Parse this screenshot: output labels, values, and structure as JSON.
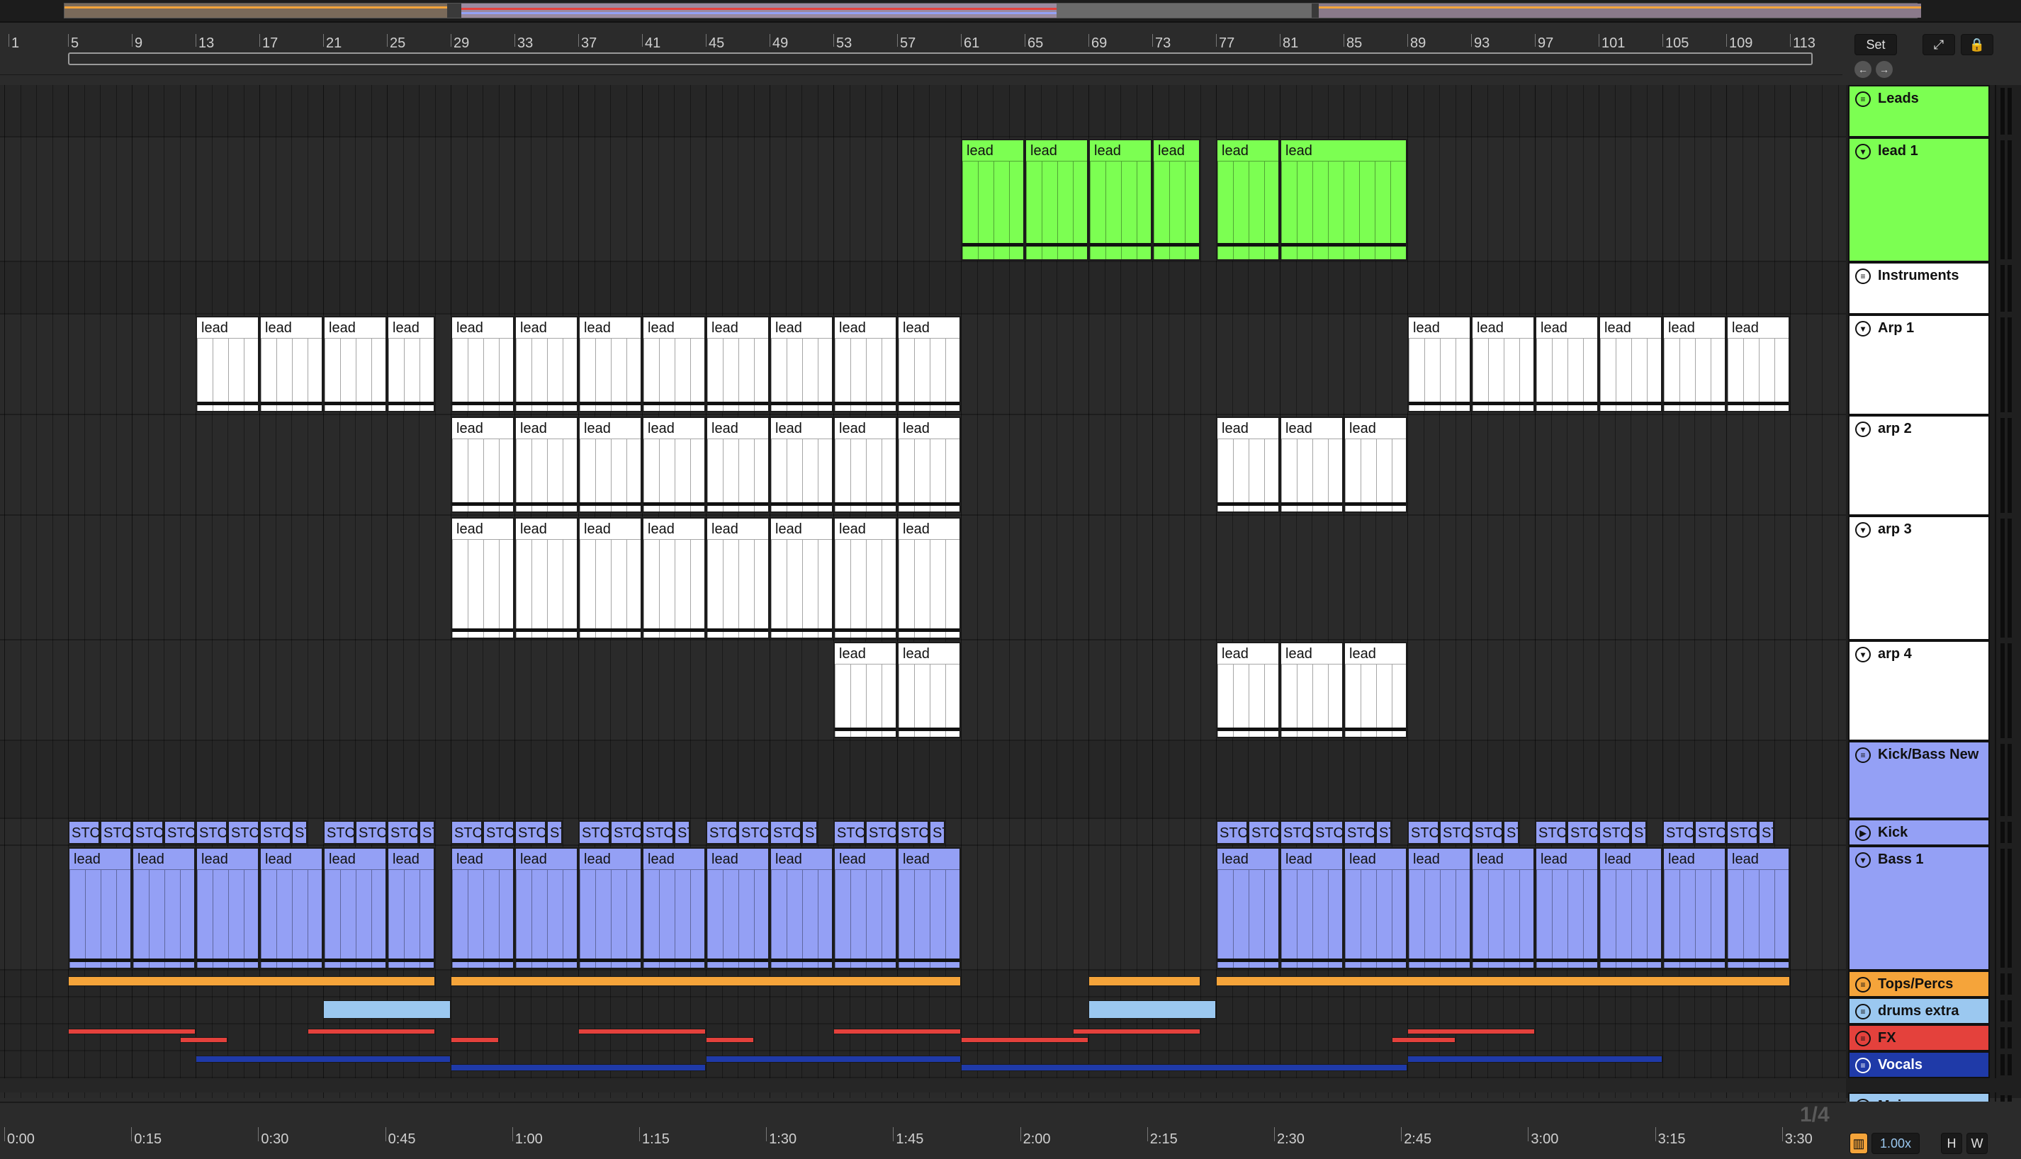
{
  "ruler": {
    "bars": [
      "1",
      "5",
      "9",
      "13",
      "17",
      "21",
      "25",
      "29",
      "33",
      "37",
      "41",
      "45",
      "49",
      "53",
      "57",
      "61",
      "65",
      "69",
      "73",
      "77",
      "81",
      "85",
      "89",
      "93",
      "97",
      "101",
      "105",
      "109",
      "113"
    ]
  },
  "timebar": {
    "labels": [
      "0:00",
      "0:15",
      "0:30",
      "0:45",
      "1:00",
      "1:15",
      "1:30",
      "1:45",
      "2:00",
      "2:15",
      "2:30",
      "2:45",
      "3:00",
      "3:15",
      "3:30"
    ],
    "grid": "1/4"
  },
  "set_panel": {
    "set_label": "Set",
    "zoom": "1.00x",
    "h_label": "H",
    "w_label": "W"
  },
  "colors": {
    "leads": "#7CFF52",
    "white": "#ffffff",
    "bass": "#94a0f5",
    "tops": "#f5a43a",
    "drums_extra": "#9bc8f0",
    "fx": "#e4413c",
    "vocals": "#1f3aa8",
    "main": "#9bc8f0"
  },
  "tracks": [
    {
      "id": "leads",
      "name": "Leads",
      "type": "group",
      "color": "#7CFF52",
      "icon": "group-icon"
    },
    {
      "id": "lead1",
      "name": "lead 1",
      "type": "midi",
      "color": "#7CFF52",
      "icon": "fold-icon"
    },
    {
      "id": "instruments",
      "name": "Instruments",
      "type": "group",
      "color": "#ffffff",
      "icon": "group-icon"
    },
    {
      "id": "arp1",
      "name": "Arp 1",
      "type": "midi",
      "color": "#ffffff",
      "icon": "fold-icon"
    },
    {
      "id": "arp2",
      "name": "arp 2",
      "type": "midi",
      "color": "#ffffff",
      "icon": "fold-icon"
    },
    {
      "id": "arp3",
      "name": "arp 3",
      "type": "midi",
      "color": "#ffffff",
      "icon": "fold-icon"
    },
    {
      "id": "arp4",
      "name": "arp 4",
      "type": "midi",
      "color": "#ffffff",
      "icon": "fold-icon"
    },
    {
      "id": "kickbass",
      "name": "Kick/Bass New",
      "type": "group",
      "color": "#94a0f5",
      "icon": "group-icon"
    },
    {
      "id": "kick",
      "name": "Kick",
      "type": "midi",
      "color": "#94a0f5",
      "icon": "play-icon"
    },
    {
      "id": "bass1",
      "name": "Bass 1",
      "type": "midi",
      "color": "#94a0f5",
      "icon": "fold-icon"
    },
    {
      "id": "tops",
      "name": "Tops/Percs",
      "type": "group",
      "color": "#f5a43a",
      "icon": "group-icon"
    },
    {
      "id": "drumsx",
      "name": "drums extra",
      "type": "group",
      "color": "#9bc8f0",
      "icon": "group-icon"
    },
    {
      "id": "fx",
      "name": "FX",
      "type": "group",
      "color": "#e4413c",
      "icon": "group-icon"
    },
    {
      "id": "vocals",
      "name": "Vocals",
      "type": "group",
      "color": "#1f3aa8",
      "icon": "group-icon"
    }
  ],
  "main_track": {
    "name": "Main",
    "color": "#9bc8f0",
    "icon": "play-icon"
  },
  "clips": {
    "lead1": [
      {
        "start": 61,
        "len": 4,
        "label": "lead"
      },
      {
        "start": 65,
        "len": 4,
        "label": "lead"
      },
      {
        "start": 69,
        "len": 4,
        "label": "lead"
      },
      {
        "start": 73,
        "len": 3,
        "label": "lead"
      },
      {
        "start": 77,
        "len": 4,
        "label": "lead"
      },
      {
        "start": 81,
        "len": 8,
        "label": "lead"
      }
    ],
    "arp1": [
      {
        "start": 13,
        "len": 4,
        "label": "lead"
      },
      {
        "start": 17,
        "len": 4,
        "label": "lead"
      },
      {
        "start": 21,
        "len": 4,
        "label": "lead"
      },
      {
        "start": 25,
        "len": 3,
        "label": "lead"
      },
      {
        "start": 29,
        "len": 4,
        "label": "lead"
      },
      {
        "start": 33,
        "len": 4,
        "label": "lead"
      },
      {
        "start": 37,
        "len": 4,
        "label": "lead"
      },
      {
        "start": 41,
        "len": 4,
        "label": "lead"
      },
      {
        "start": 45,
        "len": 4,
        "label": "lead"
      },
      {
        "start": 49,
        "len": 4,
        "label": "lead"
      },
      {
        "start": 53,
        "len": 4,
        "label": "lead"
      },
      {
        "start": 57,
        "len": 4,
        "label": "lead"
      },
      {
        "start": 89,
        "len": 4,
        "label": "lead"
      },
      {
        "start": 93,
        "len": 4,
        "label": "lead"
      },
      {
        "start": 97,
        "len": 4,
        "label": "lead"
      },
      {
        "start": 101,
        "len": 4,
        "label": "lead"
      },
      {
        "start": 105,
        "len": 4,
        "label": "lead"
      },
      {
        "start": 109,
        "len": 4,
        "label": "lead"
      }
    ],
    "arp2": [
      {
        "start": 29,
        "len": 4,
        "label": "lead"
      },
      {
        "start": 33,
        "len": 4,
        "label": "lead"
      },
      {
        "start": 37,
        "len": 4,
        "label": "lead"
      },
      {
        "start": 41,
        "len": 4,
        "label": "lead"
      },
      {
        "start": 45,
        "len": 4,
        "label": "lead"
      },
      {
        "start": 49,
        "len": 4,
        "label": "lead"
      },
      {
        "start": 53,
        "len": 4,
        "label": "lead"
      },
      {
        "start": 57,
        "len": 4,
        "label": "lead"
      },
      {
        "start": 77,
        "len": 4,
        "label": "lead"
      },
      {
        "start": 81,
        "len": 4,
        "label": "lead"
      },
      {
        "start": 85,
        "len": 4,
        "label": "lead"
      }
    ],
    "arp3": [
      {
        "start": 29,
        "len": 4,
        "label": "lead"
      },
      {
        "start": 33,
        "len": 4,
        "label": "lead"
      },
      {
        "start": 37,
        "len": 4,
        "label": "lead"
      },
      {
        "start": 41,
        "len": 4,
        "label": "lead"
      },
      {
        "start": 45,
        "len": 4,
        "label": "lead"
      },
      {
        "start": 49,
        "len": 4,
        "label": "lead"
      },
      {
        "start": 53,
        "len": 4,
        "label": "lead"
      },
      {
        "start": 57,
        "len": 4,
        "label": "lead"
      }
    ],
    "arp4": [
      {
        "start": 53,
        "len": 4,
        "label": "lead"
      },
      {
        "start": 57,
        "len": 4,
        "label": "lead"
      },
      {
        "start": 77,
        "len": 4,
        "label": "lead"
      },
      {
        "start": 81,
        "len": 4,
        "label": "lead"
      },
      {
        "start": 85,
        "len": 4,
        "label": "lead"
      }
    ],
    "kick": [
      {
        "start": 5,
        "len": 2,
        "label": "STC"
      },
      {
        "start": 7,
        "len": 2,
        "label": "STC"
      },
      {
        "start": 9,
        "len": 2,
        "label": "STC"
      },
      {
        "start": 11,
        "len": 2,
        "label": "STC"
      },
      {
        "start": 13,
        "len": 2,
        "label": "STC"
      },
      {
        "start": 15,
        "len": 2,
        "label": "STC"
      },
      {
        "start": 17,
        "len": 2,
        "label": "STC"
      },
      {
        "start": 19,
        "len": 1,
        "label": "ST"
      },
      {
        "start": 21,
        "len": 2,
        "label": "STC"
      },
      {
        "start": 23,
        "len": 2,
        "label": "STC"
      },
      {
        "start": 25,
        "len": 2,
        "label": "STC"
      },
      {
        "start": 27,
        "len": 1,
        "label": "ST"
      },
      {
        "start": 29,
        "len": 2,
        "label": "STC"
      },
      {
        "start": 31,
        "len": 2,
        "label": "STC"
      },
      {
        "start": 33,
        "len": 2,
        "label": "STC"
      },
      {
        "start": 35,
        "len": 1,
        "label": "ST"
      },
      {
        "start": 37,
        "len": 2,
        "label": "STC"
      },
      {
        "start": 39,
        "len": 2,
        "label": "STC"
      },
      {
        "start": 41,
        "len": 2,
        "label": "STC"
      },
      {
        "start": 43,
        "len": 1,
        "label": "ST"
      },
      {
        "start": 45,
        "len": 2,
        "label": "STC"
      },
      {
        "start": 47,
        "len": 2,
        "label": "STC"
      },
      {
        "start": 49,
        "len": 2,
        "label": "STC"
      },
      {
        "start": 51,
        "len": 1,
        "label": "ST"
      },
      {
        "start": 53,
        "len": 2,
        "label": "STC"
      },
      {
        "start": 55,
        "len": 2,
        "label": "STC"
      },
      {
        "start": 57,
        "len": 2,
        "label": "STC"
      },
      {
        "start": 59,
        "len": 1,
        "label": "ST"
      },
      {
        "start": 77,
        "len": 2,
        "label": "STC"
      },
      {
        "start": 79,
        "len": 2,
        "label": "STC"
      },
      {
        "start": 81,
        "len": 2,
        "label": "STC"
      },
      {
        "start": 83,
        "len": 2,
        "label": "STC"
      },
      {
        "start": 85,
        "len": 2,
        "label": "STC"
      },
      {
        "start": 87,
        "len": 1,
        "label": "ST"
      },
      {
        "start": 89,
        "len": 2,
        "label": "STC"
      },
      {
        "start": 91,
        "len": 2,
        "label": "STC"
      },
      {
        "start": 93,
        "len": 2,
        "label": "STC"
      },
      {
        "start": 95,
        "len": 1,
        "label": "ST"
      },
      {
        "start": 97,
        "len": 2,
        "label": "STC"
      },
      {
        "start": 99,
        "len": 2,
        "label": "STC"
      },
      {
        "start": 101,
        "len": 2,
        "label": "STC"
      },
      {
        "start": 103,
        "len": 1,
        "label": "ST"
      },
      {
        "start": 105,
        "len": 2,
        "label": "STC"
      },
      {
        "start": 107,
        "len": 2,
        "label": "STC"
      },
      {
        "start": 109,
        "len": 2,
        "label": "STC"
      },
      {
        "start": 111,
        "len": 1,
        "label": "ST"
      }
    ],
    "bass1": [
      {
        "start": 5,
        "len": 4,
        "label": "lead"
      },
      {
        "start": 9,
        "len": 4,
        "label": "lead"
      },
      {
        "start": 13,
        "len": 4,
        "label": "lead"
      },
      {
        "start": 17,
        "len": 4,
        "label": "lead"
      },
      {
        "start": 21,
        "len": 4,
        "label": "lead"
      },
      {
        "start": 25,
        "len": 3,
        "label": "lead"
      },
      {
        "start": 29,
        "len": 4,
        "label": "lead"
      },
      {
        "start": 33,
        "len": 4,
        "label": "lead"
      },
      {
        "start": 37,
        "len": 4,
        "label": "lead"
      },
      {
        "start": 41,
        "len": 4,
        "label": "lead"
      },
      {
        "start": 45,
        "len": 4,
        "label": "lead"
      },
      {
        "start": 49,
        "len": 4,
        "label": "lead"
      },
      {
        "start": 53,
        "len": 4,
        "label": "lead"
      },
      {
        "start": 57,
        "len": 4,
        "label": "lead"
      },
      {
        "start": 77,
        "len": 4,
        "label": "lead"
      },
      {
        "start": 81,
        "len": 4,
        "label": "lead"
      },
      {
        "start": 85,
        "len": 4,
        "label": "lead"
      },
      {
        "start": 89,
        "len": 4,
        "label": "lead"
      },
      {
        "start": 93,
        "len": 4,
        "label": "lead"
      },
      {
        "start": 97,
        "len": 4,
        "label": "lead"
      },
      {
        "start": 101,
        "len": 4,
        "label": "lead"
      },
      {
        "start": 105,
        "len": 4,
        "label": "lead"
      },
      {
        "start": 109,
        "len": 4,
        "label": "lead"
      }
    ],
    "tops": [
      {
        "start": 5,
        "len": 23
      },
      {
        "start": 29,
        "len": 32
      },
      {
        "start": 69,
        "len": 7
      },
      {
        "start": 77,
        "len": 36
      }
    ],
    "drumsx": [
      {
        "start": 21,
        "len": 8
      },
      {
        "start": 69,
        "len": 8
      }
    ],
    "fx": [
      {
        "start": 5,
        "len": 8
      },
      {
        "start": 12,
        "len": 3
      },
      {
        "start": 20,
        "len": 8
      },
      {
        "start": 29,
        "len": 3
      },
      {
        "start": 37,
        "len": 8
      },
      {
        "start": 45,
        "len": 3
      },
      {
        "start": 53,
        "len": 8
      },
      {
        "start": 61,
        "len": 8
      },
      {
        "start": 68,
        "len": 8
      },
      {
        "start": 88,
        "len": 4
      },
      {
        "start": 89,
        "len": 8
      }
    ],
    "vocals": [
      {
        "start": 13,
        "len": 16
      },
      {
        "start": 29,
        "len": 16
      },
      {
        "start": 45,
        "len": 16
      },
      {
        "start": 61,
        "len": 28
      },
      {
        "start": 89,
        "len": 16
      }
    ]
  }
}
